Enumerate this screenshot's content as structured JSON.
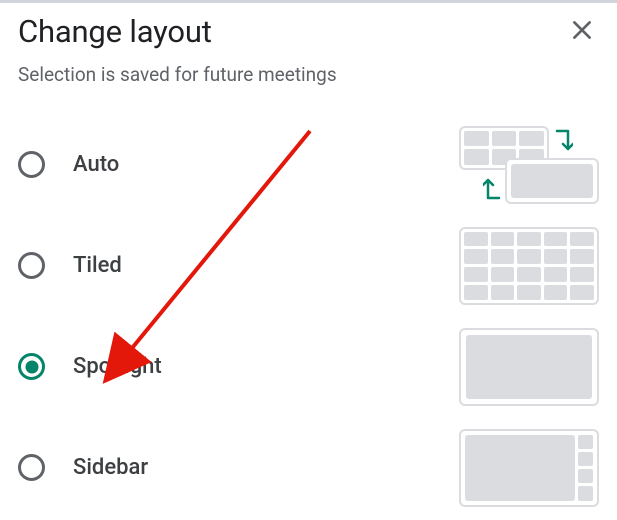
{
  "header": {
    "title": "Change layout",
    "subtitle": "Selection is saved for future meetings"
  },
  "options": [
    {
      "id": "auto",
      "label": "Auto",
      "selected": false
    },
    {
      "id": "tiled",
      "label": "Tiled",
      "selected": false
    },
    {
      "id": "spotlight",
      "label": "Spotlight",
      "selected": true
    },
    {
      "id": "sidebar",
      "label": "Sidebar",
      "selected": false
    }
  ],
  "colors": {
    "accent": "#048469",
    "annotation": "#e3170a"
  }
}
